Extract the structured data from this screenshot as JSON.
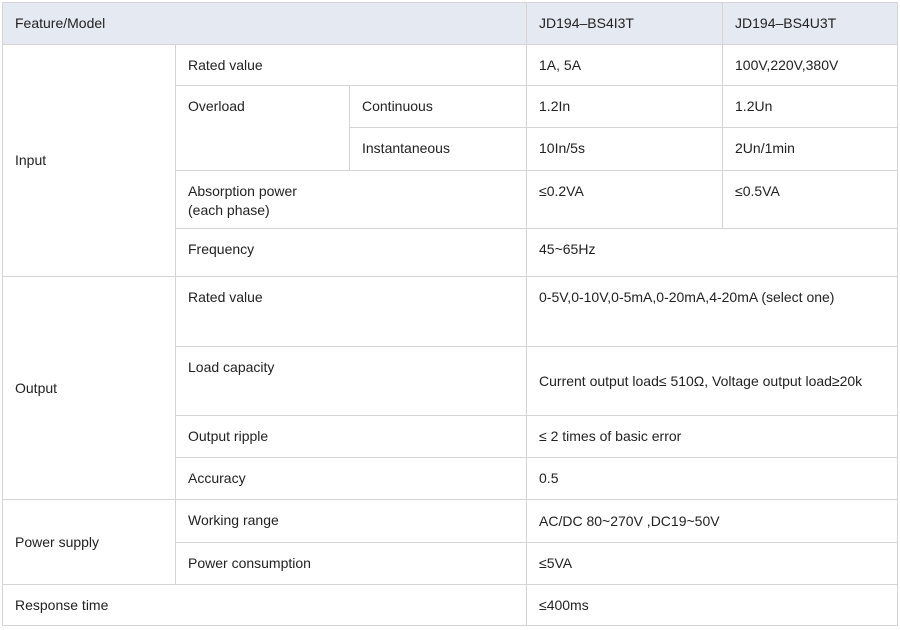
{
  "header": {
    "feature_model": "Feature/Model",
    "model_a": "JD194–BS4I3T",
    "model_b": "JD194–BS4U3T"
  },
  "input": {
    "group": "Input",
    "rated_value": {
      "label": "Rated value",
      "a": "1A, 5A",
      "b": "100V,220V,380V"
    },
    "overload": {
      "label": "Overload",
      "continuous": {
        "label": "Continuous",
        "a": "1.2In",
        "b": "1.2Un"
      },
      "instantaneous": {
        "label": "Instantaneous",
        "a": "10In/5s",
        "b": "2Un/1min"
      }
    },
    "absorption": {
      "label_line1": "Absorption power",
      "label_line2": "(each phase)",
      "a": "≤0.2VA",
      "b": "≤0.5VA"
    },
    "frequency": {
      "label": "Frequency",
      "value": "45~65Hz"
    }
  },
  "output": {
    "group": "Output",
    "rated_value": {
      "label": "Rated value",
      "value": "0-5V,0-10V,0-5mA,0-20mA,4-20mA (select one)"
    },
    "load_capacity": {
      "label": "Load capacity",
      "value": "Current output load≤ 510Ω, Voltage output load≥20k"
    },
    "output_ripple": {
      "label": "Output ripple",
      "value": "≤ 2 times of basic error"
    },
    "accuracy": {
      "label": "Accuracy",
      "value": "0.5"
    }
  },
  "power_supply": {
    "group": "Power supply",
    "working_range": {
      "label": "Working range",
      "value": "AC/DC 80~270V ,DC19~50V"
    },
    "power_consumption": {
      "label": "Power consumption",
      "value": "≤5VA"
    }
  },
  "response_time": {
    "label": "Response time",
    "value": "≤400ms"
  }
}
